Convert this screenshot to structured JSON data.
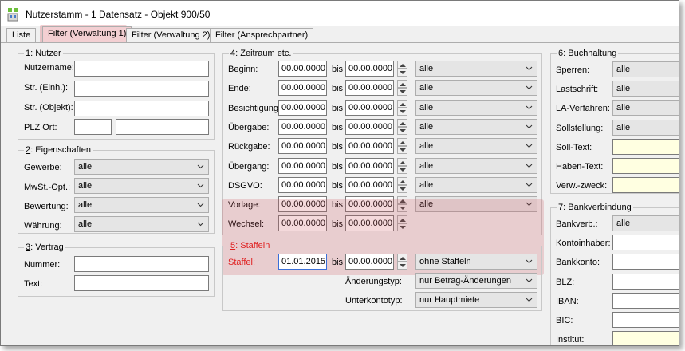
{
  "window": {
    "title": "Nutzerstamm - 1 Datensatz - Objekt 900/50"
  },
  "tabs": [
    {
      "label": "Liste"
    },
    {
      "label": "Filter (Verwaltung 1)"
    },
    {
      "label": "Filter (Verwaltung 2)"
    },
    {
      "label": "Filter (Ansprechpartner)"
    }
  ],
  "nutzer": {
    "legend_num": "1",
    "legend_text": ": Nutzer",
    "fields": [
      {
        "label": "Nutzername:",
        "value": ""
      },
      {
        "label": "Str. (Einh.):",
        "value": ""
      },
      {
        "label": "Str. (Objekt):",
        "value": ""
      },
      {
        "label": "PLZ Ort:",
        "value": ""
      }
    ]
  },
  "eigenschaften": {
    "legend_num": "2",
    "legend_text": ": Eigenschaften",
    "fields": [
      {
        "label": "Gewerbe:",
        "value": "alle"
      },
      {
        "label": "MwSt.-Opt.:",
        "value": "alle"
      },
      {
        "label": "Bewertung:",
        "value": "alle"
      },
      {
        "label": "Währung:",
        "value": "alle"
      }
    ]
  },
  "vertrag": {
    "legend_num": "3",
    "legend_text": ": Vertrag",
    "fields": [
      {
        "label": "Nummer:",
        "value": ""
      },
      {
        "label": "Text:",
        "value": ""
      }
    ]
  },
  "zeitraum": {
    "legend_num": "4",
    "legend_text": ": Zeitraum etc.",
    "bis": "bis",
    "rows": [
      {
        "label": "Beginn:",
        "from": "00.00.0000",
        "to": "00.00.0000",
        "combo": "alle"
      },
      {
        "label": "Ende:",
        "from": "00.00.0000",
        "to": "00.00.0000",
        "combo": "alle"
      },
      {
        "label": "Besichtigung:",
        "from": "00.00.0000",
        "to": "00.00.0000",
        "combo": "alle"
      },
      {
        "label": "Übergabe:",
        "from": "00.00.0000",
        "to": "00.00.0000",
        "combo": "alle"
      },
      {
        "label": "Rückgabe:",
        "from": "00.00.0000",
        "to": "00.00.0000",
        "combo": "alle"
      },
      {
        "label": "Übergang:",
        "from": "00.00.0000",
        "to": "00.00.0000",
        "combo": "alle"
      },
      {
        "label": "DSGVO:",
        "from": "00.00.0000",
        "to": "00.00.0000",
        "combo": "alle"
      },
      {
        "label": "Vorlage:",
        "from": "00.00.0000",
        "to": "00.00.0000",
        "combo": "alle"
      },
      {
        "label": "Wechsel:",
        "from": "00.00.0000",
        "to": "00.00.0000",
        "combo": ""
      }
    ]
  },
  "staffeln": {
    "legend_num": "5",
    "legend_text": ": Staffeln",
    "staffel_label": "Staffel:",
    "from": "01.01.2015",
    "bis": "bis",
    "to": "00.00.0000",
    "staffel_combo": "ohne Staffeln",
    "aenderungstyp_label": "Änderungstyp:",
    "aenderungstyp_value": "nur Betrag-Änderungen",
    "unterkontotyp_label": "Unterkontotyp:",
    "unterkontotyp_value": "nur Hauptmiete"
  },
  "buchhaltung": {
    "legend_num": "6",
    "legend_text": ": Buchhaltung",
    "fields": [
      {
        "label": "Sperren:",
        "value": "alle"
      },
      {
        "label": "Lastschrift:",
        "value": "alle"
      },
      {
        "label": "LA-Verfahren:",
        "value": "alle"
      },
      {
        "label": "Sollstellung:",
        "value": "alle"
      },
      {
        "label": "Soll-Text:",
        "value": ""
      },
      {
        "label": "Haben-Text:",
        "value": ""
      },
      {
        "label": "Verw.-zweck:",
        "value": ""
      }
    ]
  },
  "bankverbindung": {
    "legend_num": "7",
    "legend_text": ": Bankverbindung",
    "fields": [
      {
        "label": "Bankverb.:",
        "value": "alle"
      },
      {
        "label": "Kontoinhaber:",
        "value": ""
      },
      {
        "label": "Bankkonto:",
        "value": ""
      },
      {
        "label": "BLZ:",
        "value": ""
      },
      {
        "label": "IBAN:",
        "value": ""
      },
      {
        "label": "BIC:",
        "value": ""
      },
      {
        "label": "Institut:",
        "value": ""
      }
    ]
  },
  "colors": {
    "highlight": "#cd505a",
    "active_tab": "#f3cfd2",
    "yellow_field": "#ffffe1"
  }
}
